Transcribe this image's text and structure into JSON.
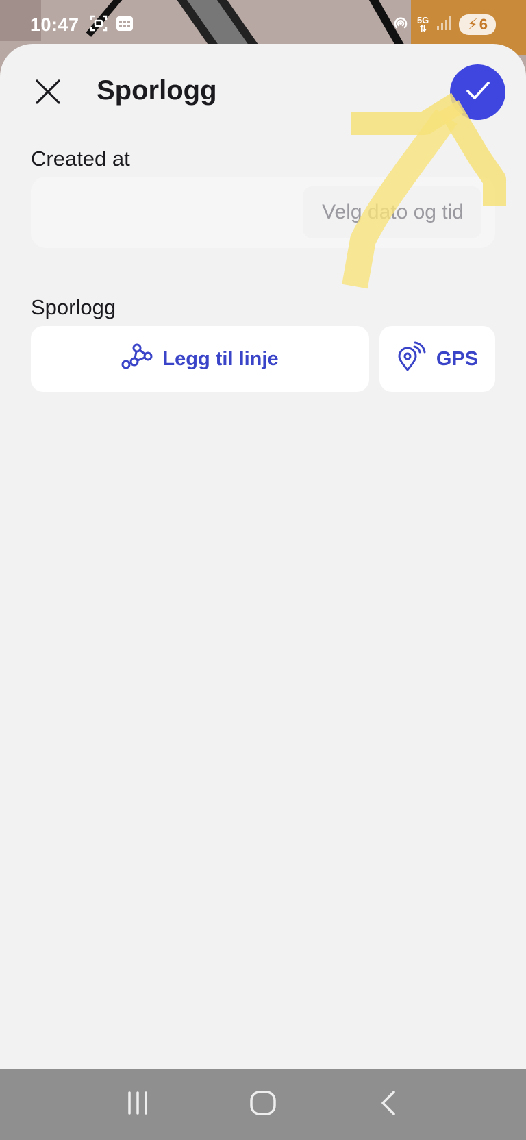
{
  "status_bar": {
    "time": "10:47",
    "network": "5G",
    "battery": "6"
  },
  "header": {
    "title": "Sporlogg",
    "close_icon": "close-icon",
    "confirm_icon": "check-icon"
  },
  "created_at": {
    "label": "Created at",
    "placeholder": "Velg dato og tid"
  },
  "track_log": {
    "label": "Sporlogg",
    "add_line_label": "Legg til linje",
    "gps_label": "GPS"
  },
  "colors": {
    "accent": "#3f46e0",
    "action_text": "#3a44c8",
    "sheet_bg": "#f2f2f3",
    "annotation": "#f7e27a"
  }
}
